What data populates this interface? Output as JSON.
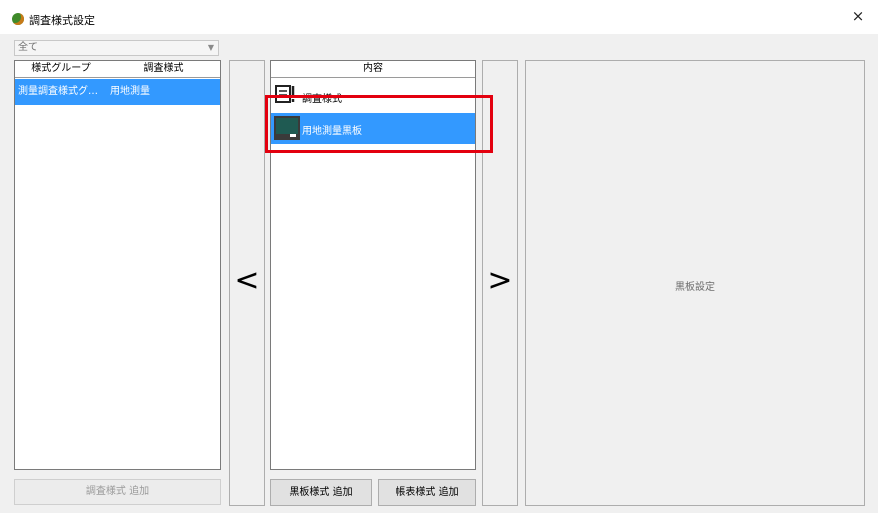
{
  "window": {
    "title": "調査様式設定",
    "close": "×"
  },
  "filter": {
    "value": "全て"
  },
  "style_grid": {
    "headers": [
      "様式グループ",
      "調査様式"
    ],
    "rows": [
      {
        "group": "測量調査様式グ…",
        "style": "用地測量"
      }
    ]
  },
  "left_buttons": {
    "add_survey_style": "調査様式 追加",
    "move_left": "<"
  },
  "content_list": {
    "header": "内容",
    "items": [
      {
        "label": "調査様式",
        "icon": "form-icon"
      },
      {
        "label": "用地測量黒板",
        "icon": "blackboard-icon"
      }
    ]
  },
  "mid_buttons": {
    "add_blackboard_style": "黒板様式 追加",
    "add_report_style": "帳表様式 追加",
    "move_right": ">"
  },
  "right_panel": {
    "label": "黒板設定"
  },
  "colors": {
    "selection": "#3399ff",
    "highlight_box": "#e3000f"
  }
}
